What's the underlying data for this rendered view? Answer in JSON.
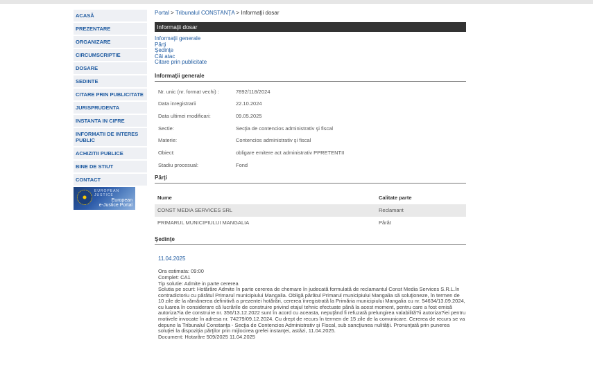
{
  "sidebar": {
    "items": [
      {
        "label": "ACASĂ"
      },
      {
        "label": "PREZENTARE"
      },
      {
        "label": "ORGANIZARE"
      },
      {
        "label": "CIRCUMSCRIPTIE"
      },
      {
        "label": "DOSARE"
      },
      {
        "label": "SEDINTE"
      },
      {
        "label": "CITARE PRIN PUBLICITATE"
      },
      {
        "label": "JURISPRUDENTA"
      },
      {
        "label": "INSTANTA IN CIFRE"
      },
      {
        "label": "INFORMATII DE INTERES PUBLIC"
      },
      {
        "label": "ACHIZITII PUBLICE"
      },
      {
        "label": "BINE DE STIUT"
      },
      {
        "label": "CONTACT"
      }
    ],
    "ejustice": {
      "small": "EUROPEAN JUSTICE",
      "line1": "European",
      "line2": "e-Justice Portal"
    }
  },
  "breadcrumb": {
    "portal": "Portal",
    "sep": ">",
    "tribunal": "Tribunalul CONSTANŢA",
    "current": "Informaţii dosar"
  },
  "title": "Informaţii dosar",
  "links": [
    "Informaţii generale",
    "Părţi",
    "Şedinţe",
    "Căi atac",
    "Citare prin publicitate"
  ],
  "general": {
    "heading": "Informaţii generale",
    "rows": [
      {
        "k": "Nr. unic (nr. format vechi) :",
        "v": "7892/118/2024"
      },
      {
        "k": "Data inregistrarii",
        "v": "22.10.2024"
      },
      {
        "k": "Data ultimei modificari:",
        "v": "09.05.2025"
      },
      {
        "k": "Sectie:",
        "v": "Secţia de contencios administrativ şi fiscal"
      },
      {
        "k": "Materie:",
        "v": "Contencios administrativ şi fiscal"
      },
      {
        "k": "Obiect:",
        "v": "obligare emitere act administrativ PPRETENTII"
      },
      {
        "k": "Stadiu procesual:",
        "v": "Fond"
      }
    ]
  },
  "parti": {
    "heading": "Părţi",
    "col_name": "Nume",
    "col_role": "Calitate parte",
    "rows": [
      {
        "name": "CONST MEDIA SERVICES SRL",
        "role": "Reclamant"
      },
      {
        "name": "PRIMARUL MUNICIPIULUI MANGALIA",
        "role": "Pârât"
      }
    ]
  },
  "sedinte": {
    "heading": "Şedinţe",
    "date": "11.04.2025",
    "lines": [
      "Ora estimata: 09:00",
      "Complet: CA1",
      "Tip solutie: Admite in parte cererea",
      "Solutia pe scurt: Hotărâre Admite în parte cererea de chemare în judecată formulată de reclamantul Const Media Services S.R.L.în contradictoriu cu pârâtul Primarul municipiului Mangalia. Obligă pârâtul Primarul municipiului Mangalia să soluţioneze, în termen de 10 zile de la rămânerea definitivă a prezentei hotărâri, cererea înregistrată la Primăria municipiului Mangalia cu nr. 54634/13.09.2024, cu luarea în considerare că lucrările de construire privind etajul tehnic efectuate până la acest moment, pentru care a fost emisă autoriza?ia de construire nr. 356/13.12.2022 sunt în acord cu aceasta, nepuţând fi refuzată prelungirea valabilită?ii autoriza?iei pentru motivele invocate în adresa nr. 74279/09.12.2024. Cu drept de recurs în termen de 15 zile de la comunicare. Cererea de recurs se va depune la Tribunalul Constanţa - Secţia de Contencios Administrativ şi Fiscal, sub sancţiunea nulităţii. Pronunţată prin punerea soluţiei la dispoziţia părţilor prin mijlocirea grefei instanţei, astăzi, 11.04.2025.",
      "Document: Hotarâre  509/2025  11.04.2025"
    ]
  }
}
